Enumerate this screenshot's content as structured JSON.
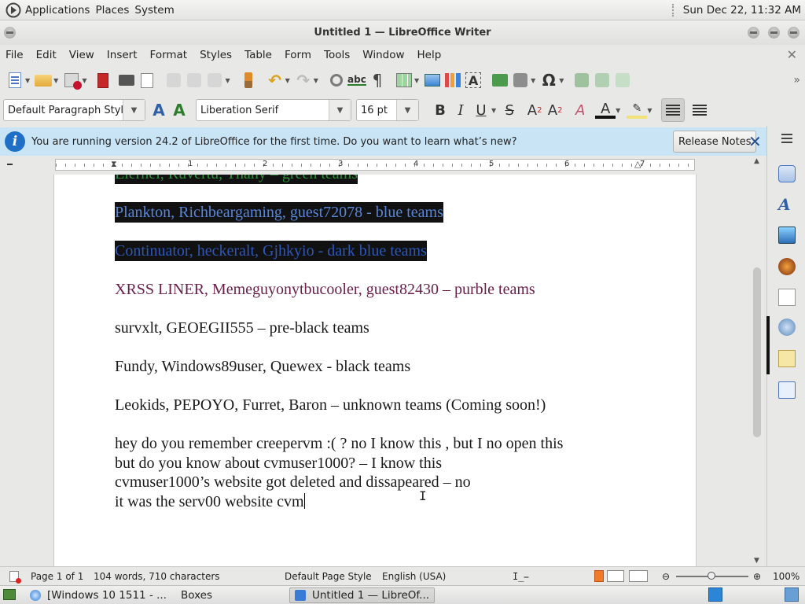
{
  "top_panel": {
    "menus": [
      "Applications",
      "Places",
      "System"
    ],
    "clock": "Sun Dec 22, 11:32 AM"
  },
  "window": {
    "title": "Untitled 1 — LibreOffice Writer"
  },
  "menubar": [
    "File",
    "Edit",
    "View",
    "Insert",
    "Format",
    "Styles",
    "Table",
    "Form",
    "Tools",
    "Window",
    "Help"
  ],
  "formatting": {
    "paragraph_style": "Default Paragraph Style",
    "font_name": "Liberation Serif",
    "font_size": "16 pt"
  },
  "infobar": {
    "message": "You are running version 24.2 of LibreOffice for the first time. Do you want to learn what’s new?",
    "button": "Release Notes"
  },
  "ruler": {
    "numbers": [
      "1",
      "2",
      "3",
      "4",
      "5",
      "6",
      "7"
    ]
  },
  "document": {
    "lines": [
      {
        "text": "Elernel, Ruvertu, Thany – green teams",
        "color": "#2f8f3a"
      },
      {
        "text": "Plankton, Richbeargaming, guest72078 - blue teams",
        "color": "#5a86d8"
      },
      {
        "text": "Continuator, heckeralt, Gjhkyio - dark blue teams",
        "color": "#2e57b8"
      },
      {
        "text": "XRSS LINER, Memeguyonytbucooler, guest82430 – purble teams",
        "color": "#6a1e4a"
      },
      {
        "text": "survxlt, GEOEGII555 – pre-black teams"
      },
      {
        "text": "Fundy, Windows89user, Quewex - black teams"
      },
      {
        "text": "Leokids, PEPOYO, Furret, Baron – unknown teams (Coming soon!)"
      }
    ],
    "chat": [
      "hey do you remember creepervm :( ? no I know this , but I no open this",
      "but do you know about cvmuser1000? – I know this",
      "cvmuser1000’s website got deleted and dissapeared – no",
      "it was the serv00 website cvm"
    ]
  },
  "statusbar": {
    "page": "Page 1 of 1",
    "counts": "104 words, 710 characters",
    "page_style": "Default Page Style",
    "language": "English (USA)",
    "zoom": "100%"
  },
  "taskbar": {
    "items": [
      "[Windows 10 1511 - ...",
      "Boxes",
      "Untitled 1 — LibreOf..."
    ]
  }
}
